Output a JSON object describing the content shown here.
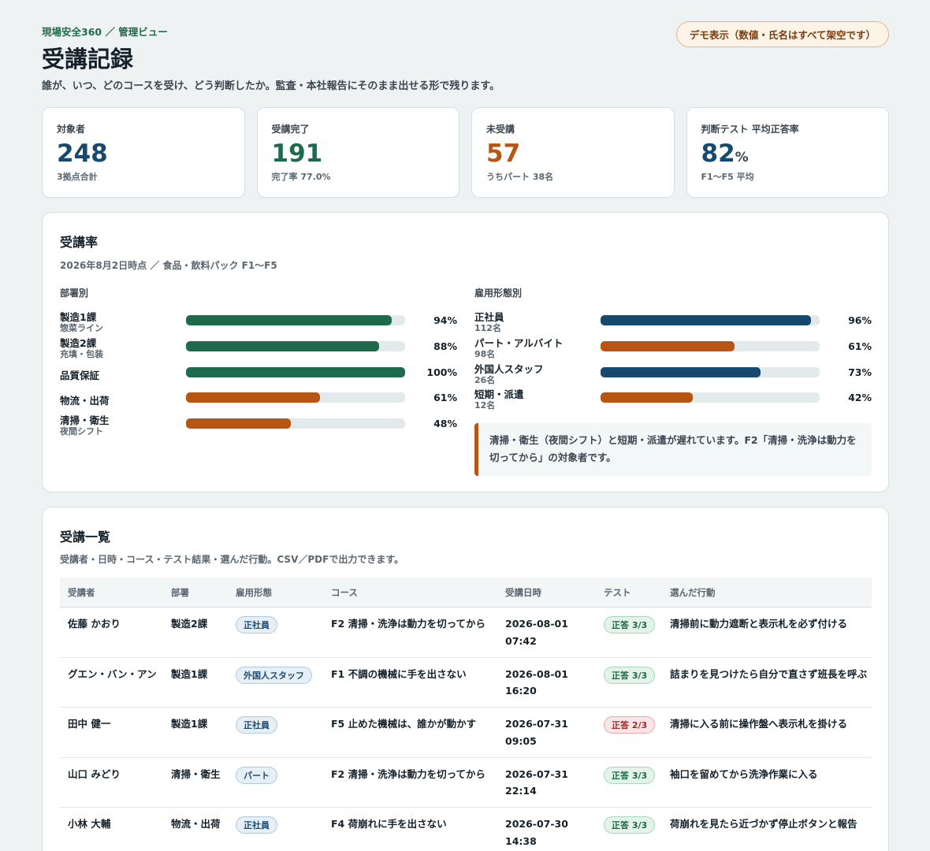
{
  "header": {
    "breadcrumb": "現場安全360 ／ 管理ビュー",
    "title": "受講記録",
    "subtitle": "誰が、いつ、どのコースを受け、どう判断したか。監査・本社報告にそのまま出せる形で残ります。",
    "demo_badge": "デモ表示（数値・氏名はすべて架空です）"
  },
  "kpis": [
    {
      "label": "対象者",
      "value": "248",
      "unit": "",
      "note": "3拠点合計",
      "color": "#17496e"
    },
    {
      "label": "受講完了",
      "value": "191",
      "unit": "",
      "note": "完了率 77.0%",
      "color": "#1e6a4c"
    },
    {
      "label": "未受講",
      "value": "57",
      "unit": "",
      "note": "うちパート 38名",
      "color": "#b85512"
    },
    {
      "label": "判断テスト 平均正答率",
      "value": "82",
      "unit": "%",
      "note": "F1〜F5 平均",
      "color": "#17496e"
    }
  ],
  "rate": {
    "title": "受講率",
    "subtitle": "2026年8月2日時点 ／ 食品・飲料パック F1〜F5",
    "dept_heading": "部署別",
    "emp_heading": "雇用形態別",
    "dept": [
      {
        "name": "製造1課",
        "sub": "惣菜ライン",
        "pct": 94,
        "label": "94%",
        "color": "#1e6a4c"
      },
      {
        "name": "製造2課",
        "sub": "充填・包装",
        "pct": 88,
        "label": "88%",
        "color": "#1e6a4c"
      },
      {
        "name": "品質保証",
        "sub": "",
        "pct": 100,
        "label": "100%",
        "color": "#1e6a4c"
      },
      {
        "name": "物流・出荷",
        "sub": "",
        "pct": 61,
        "label": "61%",
        "color": "#b85512"
      },
      {
        "name": "清掃・衛生",
        "sub": "夜間シフト",
        "pct": 48,
        "label": "48%",
        "color": "#b85512"
      }
    ],
    "emp": [
      {
        "name": "正社員",
        "sub": "112名",
        "pct": 96,
        "label": "96%",
        "color": "#17496e"
      },
      {
        "name": "パート・アルバイト",
        "sub": "98名",
        "pct": 61,
        "label": "61%",
        "color": "#b85512"
      },
      {
        "name": "外国人スタッフ",
        "sub": "26名",
        "pct": 73,
        "label": "73%",
        "color": "#17496e"
      },
      {
        "name": "短期・派遣",
        "sub": "12名",
        "pct": 42,
        "label": "42%",
        "color": "#b85512"
      }
    ],
    "callout": "清掃・衛生（夜間シフト）と短期・派遣が遅れています。F2「清掃・洗浄は動力を切ってから」の対象者です。"
  },
  "list": {
    "title": "受講一覧",
    "subtitle": "受講者・日時・コース・テスト結果・選んだ行動。CSV／PDFで出力できます。",
    "columns": [
      "受講者",
      "部署",
      "雇用形態",
      "コース",
      "受講日時",
      "テスト",
      "選んだ行動"
    ],
    "rows": [
      {
        "name": "佐藤 かおり",
        "dept": "製造2課",
        "emp": "正社員",
        "course": "F2 清掃・洗浄は動力を切ってから",
        "date": "2026-08-01",
        "time": "07:42",
        "test": "正答 3/3",
        "test_ok": true,
        "action": "清掃前に動力遮断と表示札を必ず付ける"
      },
      {
        "name": "グエン・バン・アン",
        "dept": "製造1課",
        "emp": "外国人スタッフ",
        "course": "F1 不調の機械に手を出さない",
        "date": "2026-08-01",
        "time": "16:20",
        "test": "正答 3/3",
        "test_ok": true,
        "action": "詰まりを見つけたら自分で直さず班長を呼ぶ"
      },
      {
        "name": "田中 健一",
        "dept": "製造1課",
        "emp": "正社員",
        "course": "F5 止めた機械は、誰かが動かす",
        "date": "2026-07-31",
        "time": "09:05",
        "test": "正答 2/3",
        "test_ok": false,
        "action": "清掃に入る前に操作盤へ表示札を掛ける"
      },
      {
        "name": "山口 みどり",
        "dept": "清掃・衛生",
        "emp": "パート",
        "course": "F2 清掃・洗浄は動力を切ってから",
        "date": "2026-07-31",
        "time": "22:14",
        "test": "正答 3/3",
        "test_ok": true,
        "action": "袖口を留めてから洗浄作業に入る"
      },
      {
        "name": "小林 大輔",
        "dept": "物流・出荷",
        "emp": "正社員",
        "course": "F4 荷崩れに手を出さない",
        "date": "2026-07-30",
        "time": "14:38",
        "test": "正答 3/3",
        "test_ok": true,
        "action": "荷崩れを見たら近づかず停止ボタンと報告"
      }
    ]
  }
}
